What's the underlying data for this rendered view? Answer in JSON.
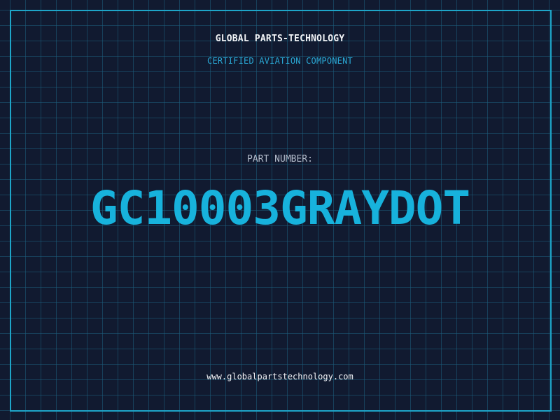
{
  "label": {
    "company_name": "GLOBAL PARTS-TECHNOLOGY",
    "subtitle": "CERTIFIED AVIATION COMPONENT",
    "part_number_label": "PART NUMBER:",
    "part_number": "GC10003GRAYDOT",
    "website": "www.globalpartstechnology.com"
  },
  "colors": {
    "background": "#111a30",
    "grid_line": "#1b5f7d",
    "frame_border": "#1ea5c8",
    "accent": "#17b2dc",
    "primary_text": "#f2f4f7",
    "muted_text": "#b3bccb"
  }
}
